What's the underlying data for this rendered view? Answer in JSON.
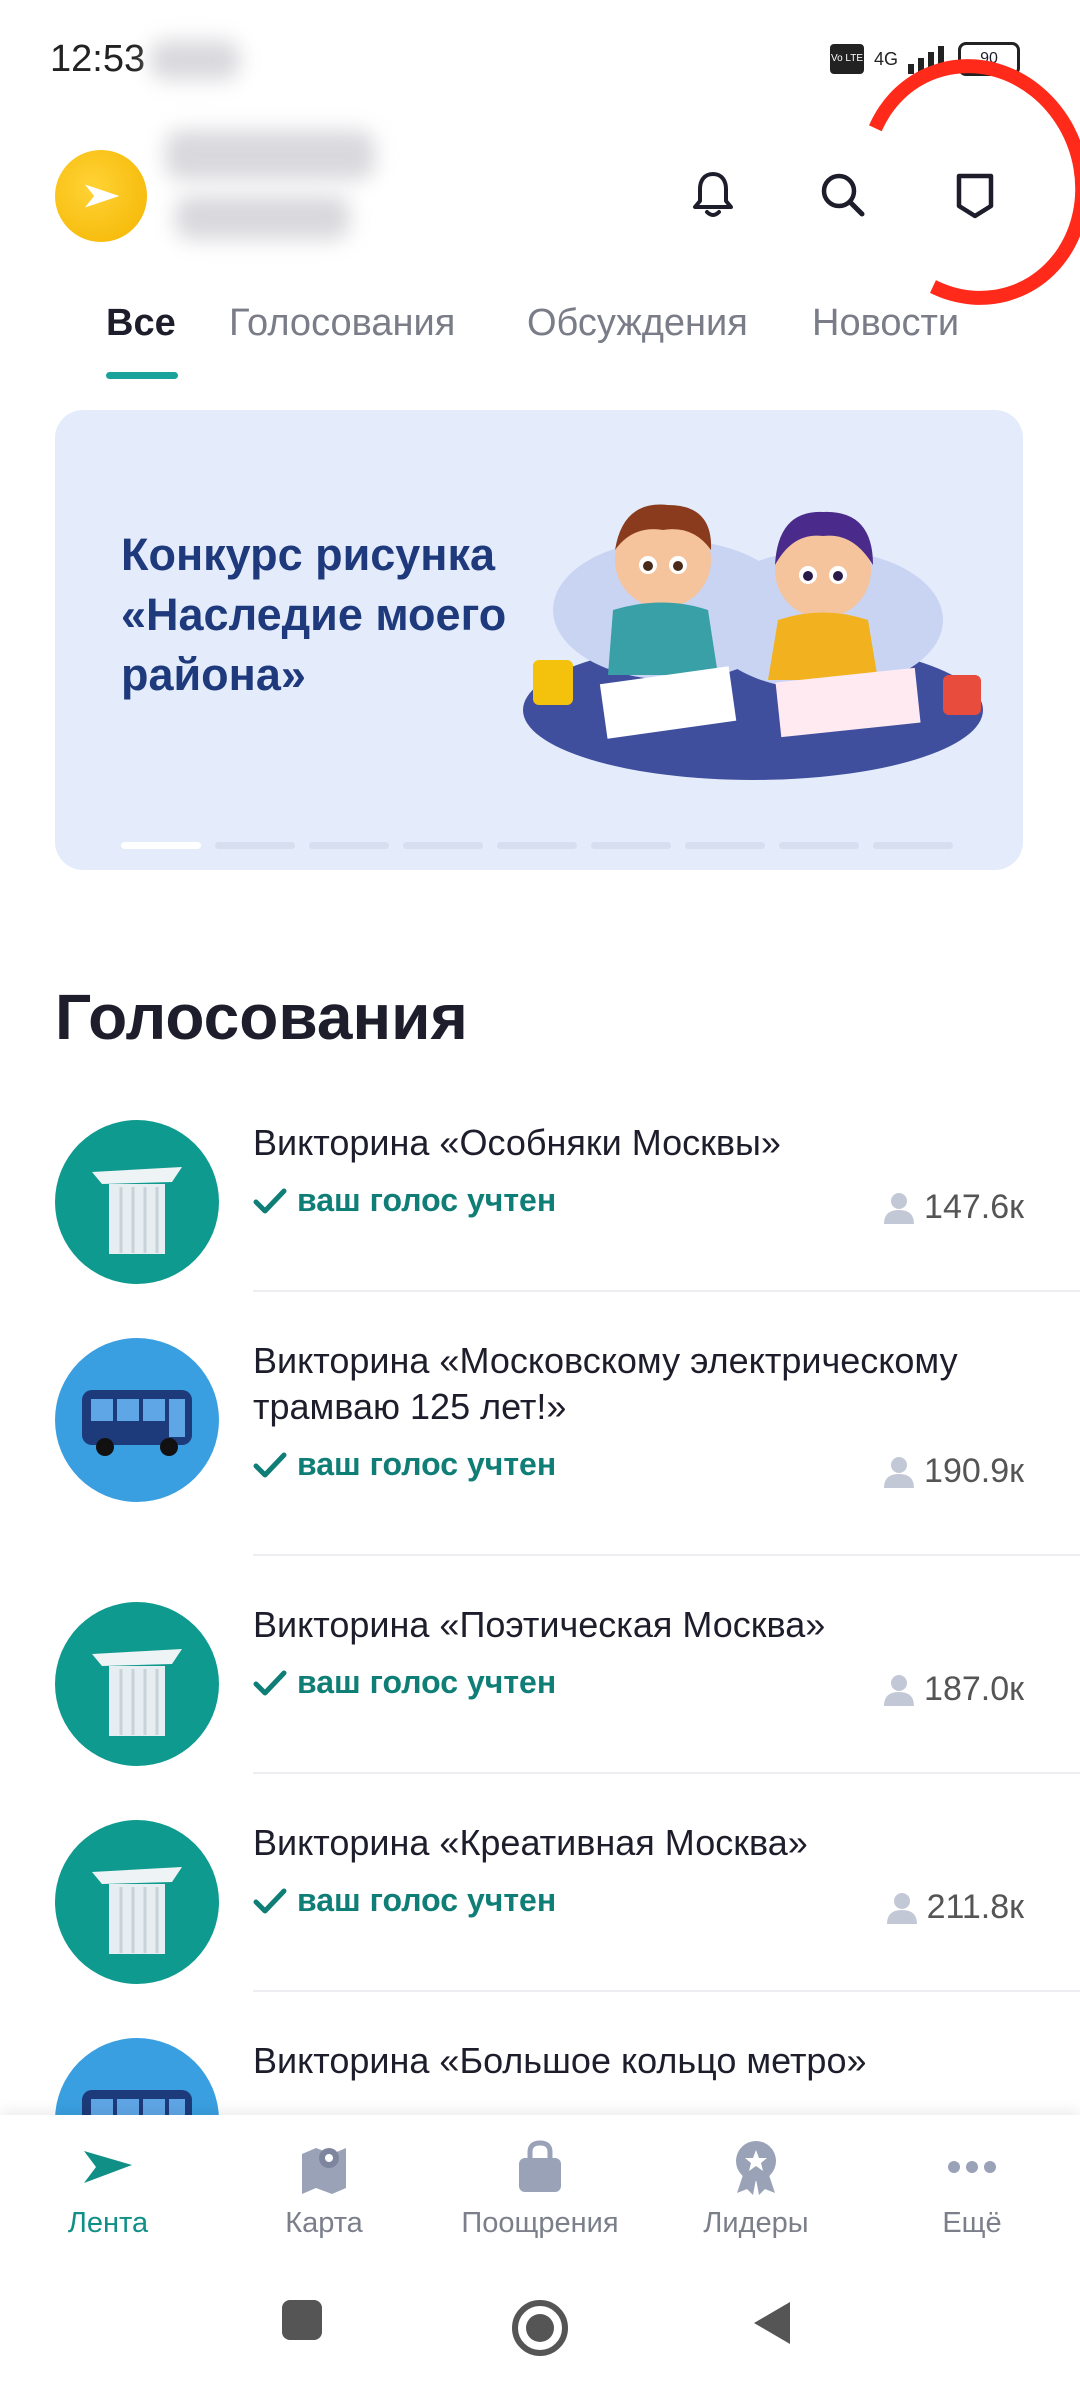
{
  "status_bar": {
    "time": "12:53",
    "network": "4G",
    "volte": "Vo LTE",
    "battery": "90"
  },
  "header": {
    "icons": [
      "bell-icon",
      "search-icon",
      "bookmark-icon"
    ]
  },
  "tabs": [
    {
      "label": "Все",
      "active": true
    },
    {
      "label": "Голосования",
      "active": false
    },
    {
      "label": "Обсуждения",
      "active": false
    },
    {
      "label": "Новости",
      "active": false
    }
  ],
  "banner": {
    "title": "Конкурс рисунка «Наследие моего района»",
    "slides_total": 9,
    "active_slide": 1
  },
  "section": {
    "title": "Голосования"
  },
  "votes": [
    {
      "title": "Викторина «Особняки Москвы»",
      "status": "ваш голос учтен",
      "count": "147.6к",
      "icon": "column-icon",
      "color": "teal"
    },
    {
      "title": "Викторина «Московскому электрическому трамваю 125 лет!»",
      "status": "ваш голос учтен",
      "count": "190.9к",
      "icon": "bus-icon",
      "color": "blue"
    },
    {
      "title": "Викторина «Поэтическая Москва»",
      "status": "ваш голос учтен",
      "count": "187.0к",
      "icon": "column-icon",
      "color": "teal"
    },
    {
      "title": "Викторина «Креативная Москва»",
      "status": "ваш голос учтен",
      "count": "211.8к",
      "icon": "column-icon",
      "color": "teal"
    },
    {
      "title": "Викторина «Большое кольцо метро»",
      "status": "",
      "count": "",
      "icon": "bus-icon",
      "color": "blue"
    }
  ],
  "bottom_nav": [
    {
      "label": "Лента",
      "icon": "feed-icon",
      "active": true
    },
    {
      "label": "Карта",
      "icon": "map-icon",
      "active": false
    },
    {
      "label": "Поощрения",
      "icon": "bag-icon",
      "active": false
    },
    {
      "label": "Лидеры",
      "icon": "medal-icon",
      "active": false
    },
    {
      "label": "Ещё",
      "icon": "more-icon",
      "active": false
    }
  ],
  "colors": {
    "accent": "#1aa39a",
    "voted": "#0f7e76",
    "banner_bg": "#e4ecfb",
    "annotation": "#ff2a1a"
  }
}
